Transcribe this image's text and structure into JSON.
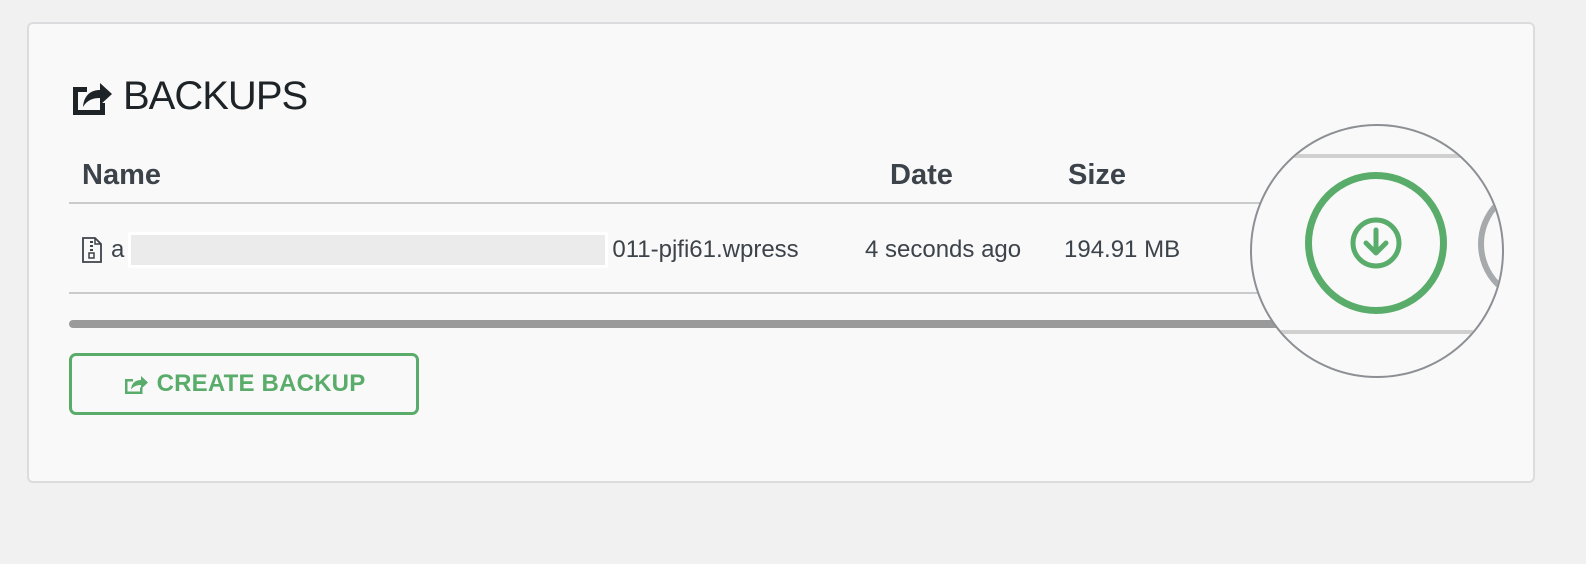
{
  "panel": {
    "title": "BACKUPS",
    "title_icon": "share-export-icon"
  },
  "table": {
    "columns": [
      "Name",
      "Date",
      "Size"
    ],
    "rows": [
      {
        "name_prefix": "a",
        "name_suffix": "011-pjfi61.wpress",
        "date": "4 seconds ago",
        "size": "194.91 MB",
        "icon": "zip-file-icon"
      }
    ]
  },
  "actions": {
    "create_backup_label": "CREATE BACKUP",
    "create_backup_icon": "share-export-icon",
    "download_icon": "download-circle-arrow-icon"
  },
  "colors": {
    "accent_green": "#5aac6a",
    "text": "#3c434a",
    "panel_bg": "#f9f9f9",
    "page_bg": "#f1f1f1"
  }
}
